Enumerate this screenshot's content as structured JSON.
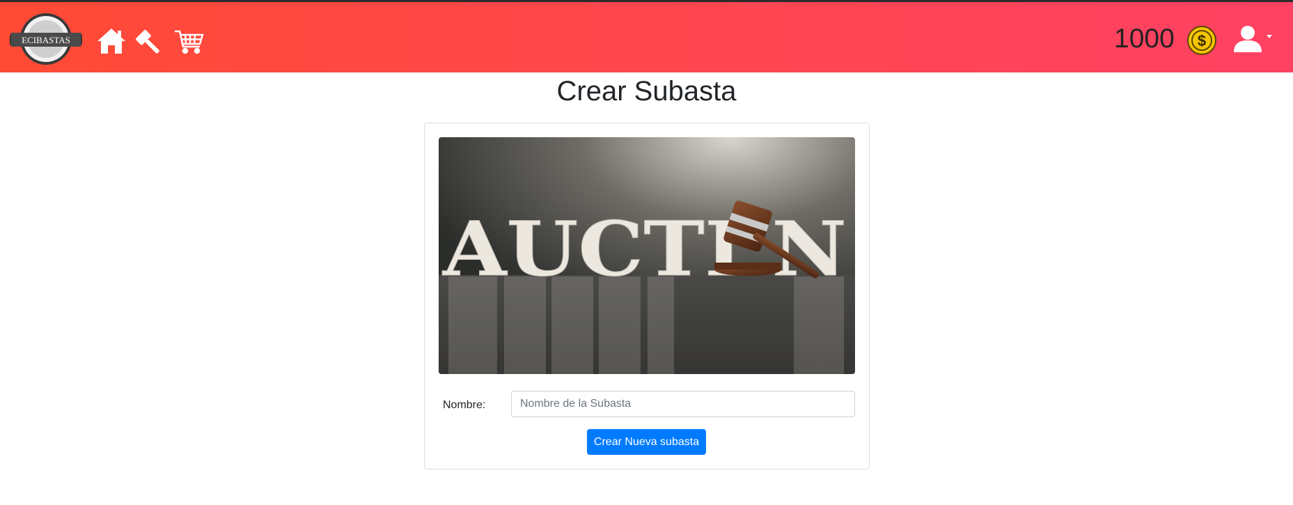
{
  "navbar": {
    "brand": "ECIBASTAS",
    "icons": [
      "home-icon",
      "gavel-icon",
      "shopping-cart-icon"
    ],
    "coin_balance": "1000",
    "coin_icon": "dollar-coin-icon",
    "user_icon": "user-icon",
    "gradient_start": "#ff4a35",
    "gradient_end": "#ff4163"
  },
  "page": {
    "title": "Crear Subasta"
  },
  "form": {
    "image_letters": "AUCTI N",
    "name_label": "Nombre:",
    "name_value": "",
    "name_placeholder": "Nombre de la Subasta",
    "submit_label": "Crear Nueva subasta",
    "button_color": "#007bff"
  }
}
